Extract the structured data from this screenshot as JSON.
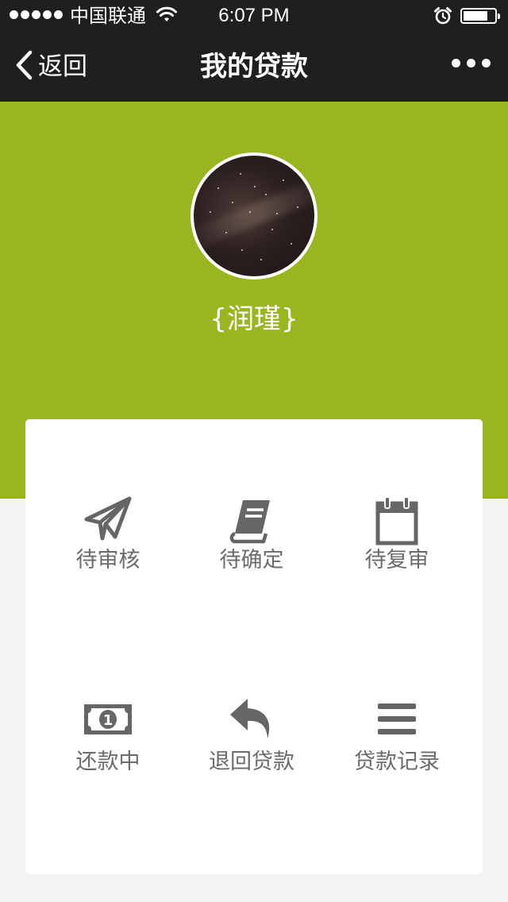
{
  "status_bar": {
    "carrier": "中国联通",
    "time": "6:07 PM",
    "battery_level": 0.8,
    "icons": [
      "signal-dots-icon",
      "wifi-icon",
      "alarm-icon",
      "battery-icon"
    ]
  },
  "nav": {
    "back_label": "返回",
    "title": "我的贷款",
    "back_icon": "chevron-left-icon",
    "more_icon": "more-dots-icon"
  },
  "profile": {
    "name": "{润瑾}",
    "avatar_icon": "starry-sky-avatar"
  },
  "menu": {
    "items": [
      {
        "label": "待审核",
        "icon": "paper-plane-icon"
      },
      {
        "label": "待确定",
        "icon": "book-icon"
      },
      {
        "label": "待复审",
        "icon": "calendar-icon"
      },
      {
        "label": "还款中",
        "icon": "banknote-icon"
      },
      {
        "label": "退回贷款",
        "icon": "reply-arrow-icon"
      },
      {
        "label": "贷款记录",
        "icon": "list-icon"
      }
    ]
  },
  "colors": {
    "header_bg": "#1f1f21",
    "accent_green": "#99b51f",
    "page_bg": "#f4f4f4",
    "card_bg": "#ffffff",
    "icon_gray": "#666666",
    "label_gray": "#6b6b6b"
  }
}
